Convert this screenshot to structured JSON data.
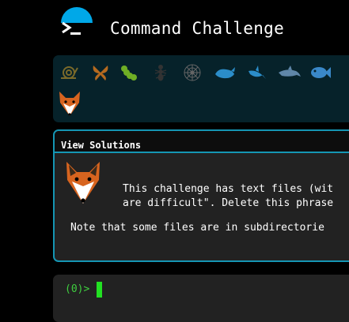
{
  "header": {
    "title": "Command Challenge"
  },
  "creatures": [
    "snail-icon",
    "butterfly-icon",
    "caterpillar-icon",
    "ant-icon",
    "spider-web-icon",
    "whale-icon",
    "shark-icon",
    "dolphin-icon",
    "fish-icon",
    "fox-icon"
  ],
  "panel": {
    "header_label": "View Solutions",
    "description_line1": "This challenge has text files (wit",
    "description_line2": "are difficult\". Delete this phrase",
    "note": "Note that some files are in subdirectorie"
  },
  "terminal": {
    "prompt": "(0)>"
  },
  "colors": {
    "accent": "#1596b4",
    "prompt_green": "#3fcf3f",
    "cursor_green": "#22e022"
  }
}
